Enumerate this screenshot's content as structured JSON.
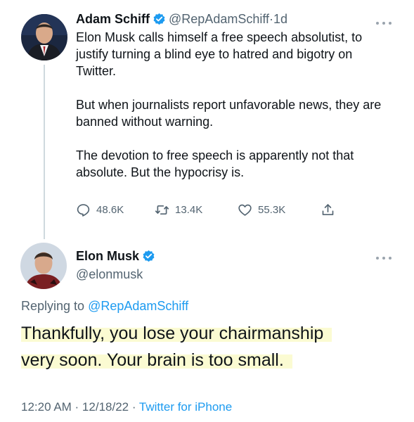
{
  "tweet1": {
    "author_name": "Adam Schiff",
    "handle": "@RepAdamSchiff",
    "separator": " · ",
    "time": "1d",
    "paragraphs": [
      "Elon Musk calls himself a free speech absolutist, to justify turning a blind eye to hatred and bigotry on Twitter.",
      "But when journalists report unfavorable news, they are banned without warning.",
      "The devotion to free speech is apparently not that absolute. But the hypocrisy is."
    ],
    "stats": {
      "replies": "48.6K",
      "retweets": "13.4K",
      "likes": "55.3K"
    }
  },
  "tweet2": {
    "author_name": "Elon Musk",
    "handle": "@elonmusk",
    "replying_prefix": "Replying to ",
    "replying_to": "@RepAdamSchiff",
    "text_line1": "Thankfully, you lose your chairmanship",
    "text_line2": "very soon. Your brain is too small.",
    "timestamp": "12:20 AM · 12/18/22 · ",
    "source": "Twitter for iPhone"
  },
  "icons": {
    "verified": "verified-badge-icon",
    "reply": "speech-bubble-icon",
    "retweet": "retweet-arrows-icon",
    "like": "heart-icon",
    "share": "share-upload-icon",
    "more": "more-dots-icon"
  },
  "colors": {
    "verified_blue": "#1d9bf0",
    "link_blue": "#1d9bf0",
    "secondary_text": "#536471",
    "highlight": "#fbfbd2"
  }
}
